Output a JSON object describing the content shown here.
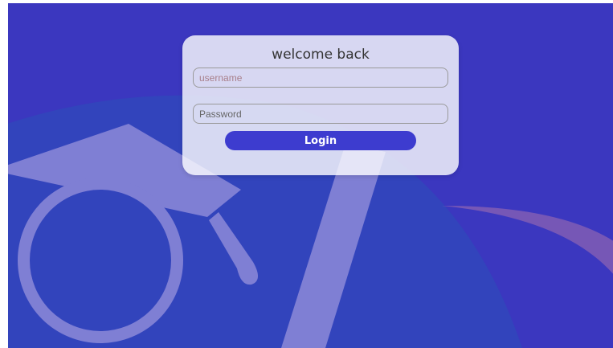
{
  "login": {
    "title": "welcome back",
    "username_placeholder": "username",
    "username_value": "",
    "password_placeholder": "Password",
    "password_value": "",
    "button_label": "Login"
  },
  "colors": {
    "background": "#3b37bf",
    "accent": "#3d3ccf",
    "card": "#ffffff"
  },
  "icons": [
    "graduation-cap-logo",
    "pen-stroke-decoration",
    "swoosh-decoration"
  ]
}
